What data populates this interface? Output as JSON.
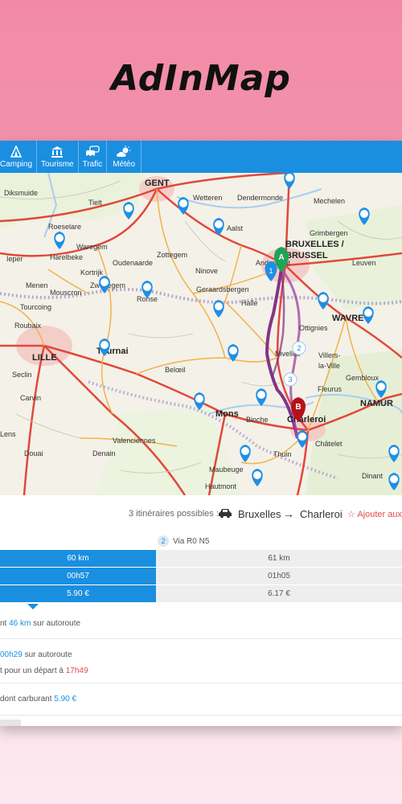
{
  "app_title": "AdInMap",
  "nav": {
    "items": [
      {
        "label": "Camping",
        "icon": "tent-icon"
      },
      {
        "label": "Tourisme",
        "icon": "monument-icon"
      },
      {
        "label": "Trafic",
        "icon": "cars-icon"
      },
      {
        "label": "Météo",
        "icon": "weather-icon"
      }
    ]
  },
  "map": {
    "places": {
      "gent": "GENT",
      "dendermonde": "Dendermonde",
      "mechelen": "Mechelen",
      "bruxelles": "BRUXELLES /",
      "brussel": "BRUSSEL",
      "leuven": "Leuven",
      "aalst": "Aalst",
      "wavre": "WAVRE",
      "lille": "LILLE",
      "roubaix": "Roubaix",
      "tournai": "Tournai",
      "mouscron": "Mouscron",
      "mons": "Mons",
      "charleroi": "Charleroi",
      "namur": "NAMUR",
      "valenciennes": "Valenciennes",
      "maubeuge": "Maubeuge",
      "dinant": "Dinant",
      "halle": "Halle",
      "nivelles": "Nivelles",
      "beloeil": "Belœil",
      "zottegem": "Zottegem",
      "ninove": "Ninove",
      "oudenaarde": "Oudenaarde",
      "tourcoing": "Tourcoing",
      "wetteren": "Wetteren",
      "ottignies": "Ottignies",
      "binche": "Binche",
      "fleurus": "Fleurus",
      "thuin": "Thuin",
      "waregem": "Waregem",
      "kortrijk": "Kortrijk",
      "ieper": "Ieper",
      "menen": "Menen",
      "denain": "Denain",
      "douai": "Douai",
      "seclin": "Seclin",
      "carvin": "Carvin",
      "lens": "Lens",
      "hautmont": "Hautmont",
      "chatelet": "Châtelet",
      "tielt": "Tielt",
      "diksmuide": "Diksmuide",
      "anderlecht": "Anderlecht",
      "geraardsbergen": "Geraardsbergen",
      "roeselare": "Roeselare",
      "harelbeke": "Harelbeke",
      "zwevegem": "Zwevegem",
      "ronse": "Ronse",
      "grimbergen": "Grimbergen",
      "villers": "Villers-",
      "laville": "la-Ville",
      "gembloux": "Gembloux"
    },
    "marker_a": "A",
    "marker_b": "B",
    "waypoint_1": "1",
    "waypoint_2": "2",
    "waypoint_3": "3"
  },
  "itinerary": {
    "count_label": "3 itinéraires possibles :",
    "from": "Bruxelles",
    "arrow": "→",
    "to": "Charleroi",
    "add_label": "Ajouter aux"
  },
  "route_tab": {
    "number": "2",
    "label": "Via R0 N5"
  },
  "comparison": {
    "rows": [
      {
        "selected": "60 km",
        "other": "61 km"
      },
      {
        "selected": "00h57",
        "other": "01h05"
      },
      {
        "selected": "5.90 €",
        "other": "6.17 €"
      }
    ]
  },
  "details": {
    "row1_prefix": "nt",
    "row1_value": "46 km",
    "row1_suffix": "sur autoroute",
    "row2_value": "00h29",
    "row2_suffix": "sur autoroute",
    "row2b_prefix": "t pour un départ à",
    "row2b_value": "17h49",
    "row3_prefix": "dont carburant",
    "row3_value": "5.90 €"
  },
  "colors": {
    "accent": "#1a8fe0",
    "route": "#7b2b83",
    "marker_a": "#1fa35a",
    "marker_b": "#b5121b",
    "favorite": "#e04b4b"
  }
}
